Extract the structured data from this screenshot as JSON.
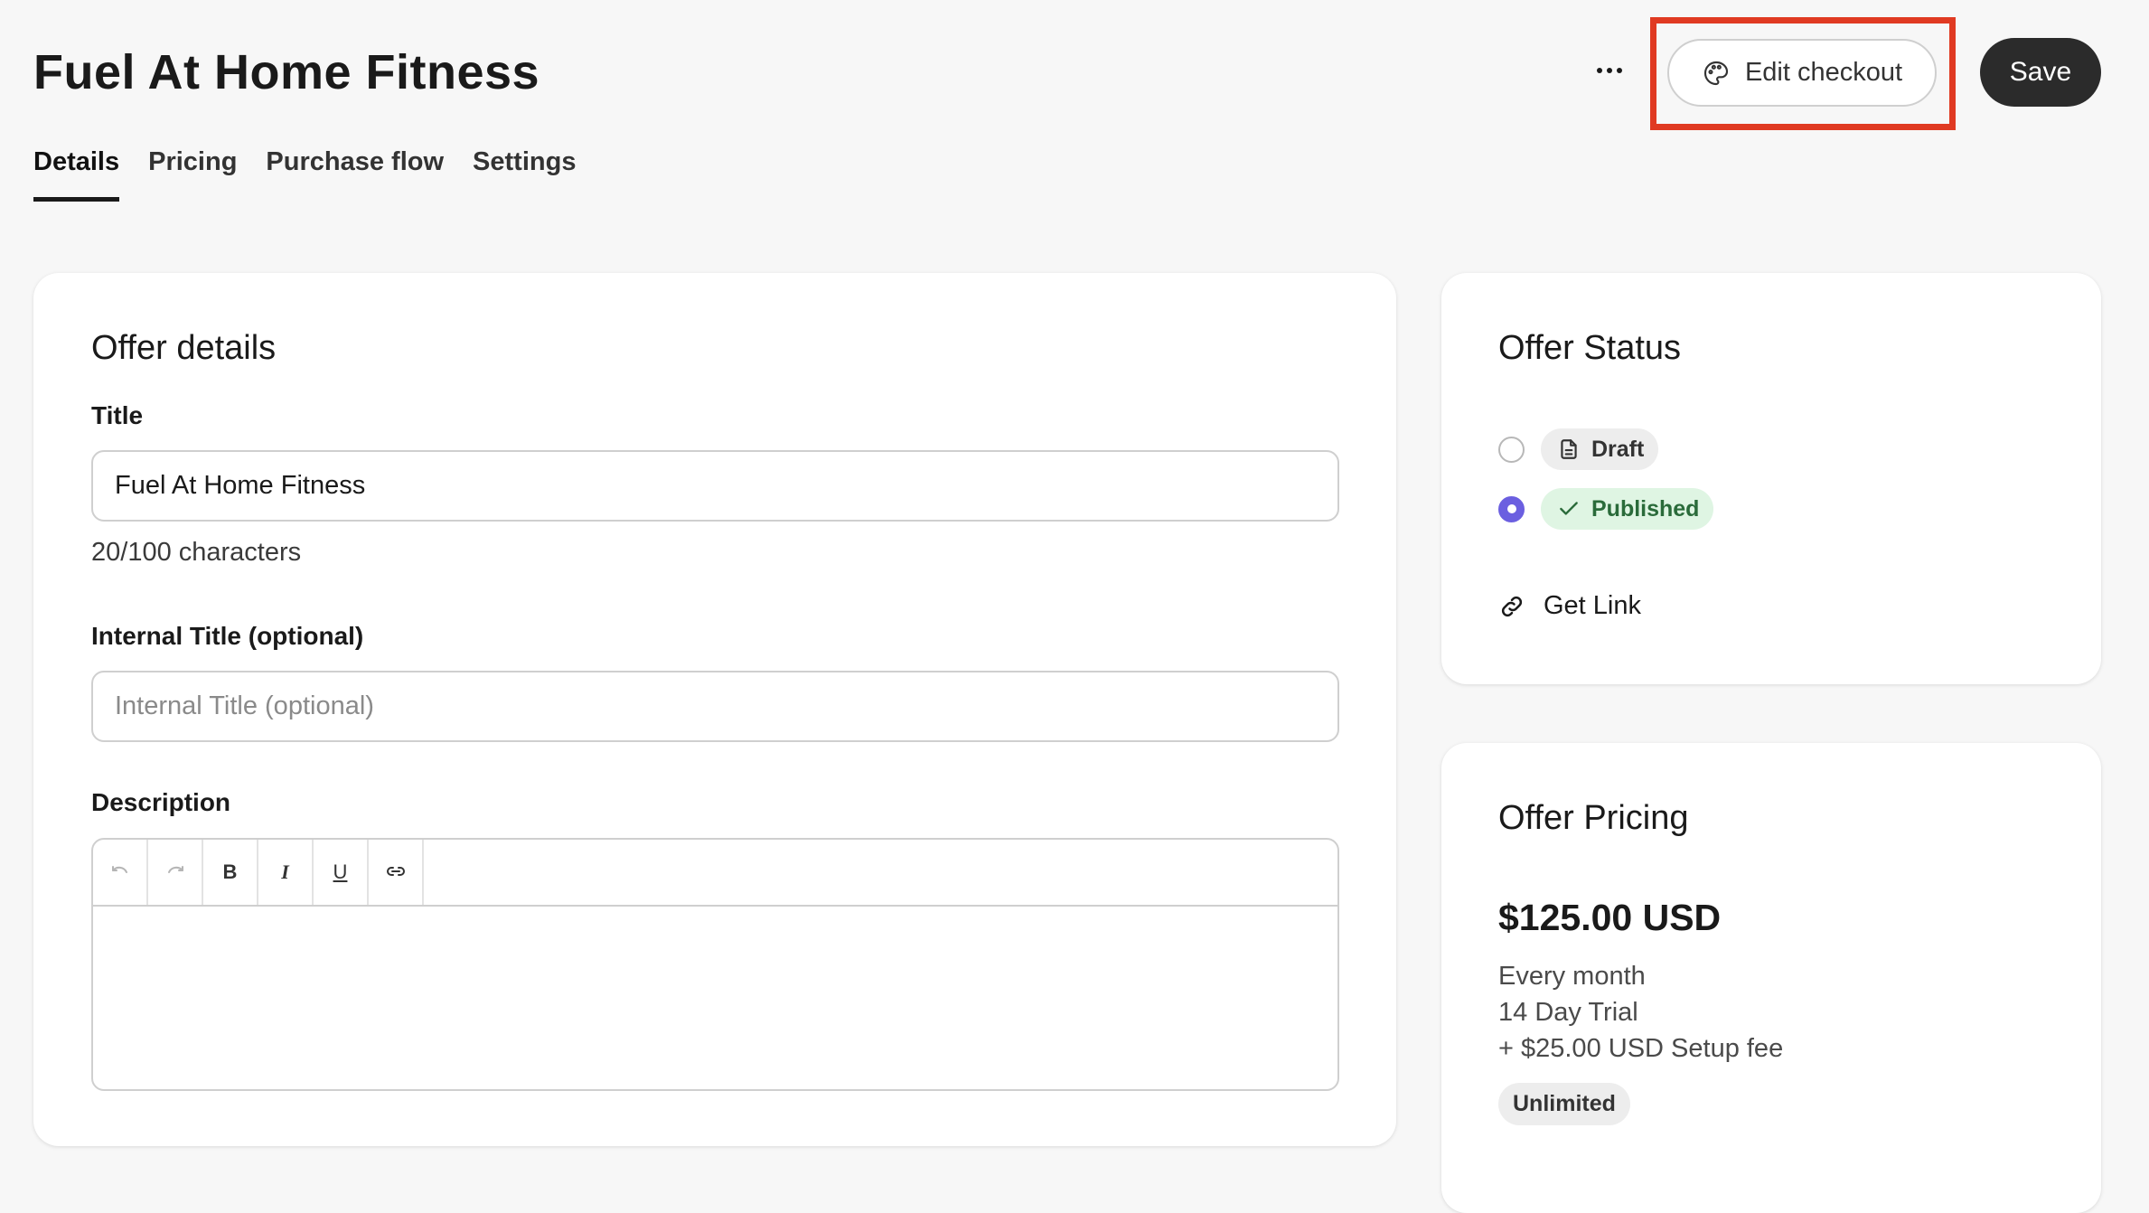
{
  "header": {
    "title": "Fuel At Home Fitness",
    "more_icon": "more-horizontal-icon",
    "edit_checkout_label": "Edit checkout",
    "edit_checkout_icon": "palette-icon",
    "save_label": "Save",
    "highlight_color": "#e03a22"
  },
  "tabs": [
    {
      "label": "Details",
      "active": true
    },
    {
      "label": "Pricing",
      "active": false
    },
    {
      "label": "Purchase flow",
      "active": false
    },
    {
      "label": "Settings",
      "active": false
    }
  ],
  "offer_details": {
    "heading": "Offer details",
    "title_label": "Title",
    "title_value": "Fuel At Home Fitness",
    "char_count": "20/100 characters",
    "internal_title_label": "Internal Title (optional)",
    "internal_title_placeholder": "Internal Title (optional)",
    "internal_title_value": "",
    "description_label": "Description",
    "toolbar": [
      {
        "name": "undo-icon",
        "enabled": false
      },
      {
        "name": "redo-icon",
        "enabled": false
      },
      {
        "name": "bold-icon",
        "label": "B",
        "enabled": true
      },
      {
        "name": "italic-icon",
        "label": "I",
        "enabled": true
      },
      {
        "name": "underline-icon",
        "label": "U",
        "enabled": true
      },
      {
        "name": "link-icon",
        "enabled": true
      }
    ],
    "description_value": ""
  },
  "offer_status": {
    "heading": "Offer Status",
    "options": [
      {
        "label": "Draft",
        "icon": "document-icon",
        "selected": false
      },
      {
        "label": "Published",
        "icon": "check-icon",
        "selected": true
      }
    ],
    "get_link_label": "Get Link",
    "radio_color": "#6b5fe0"
  },
  "offer_pricing": {
    "heading": "Offer Pricing",
    "price": "$125.00 USD",
    "frequency": "Every month",
    "trial": "14 Day Trial",
    "setup_fee": "+ $25.00 USD Setup fee",
    "badge": "Unlimited"
  }
}
